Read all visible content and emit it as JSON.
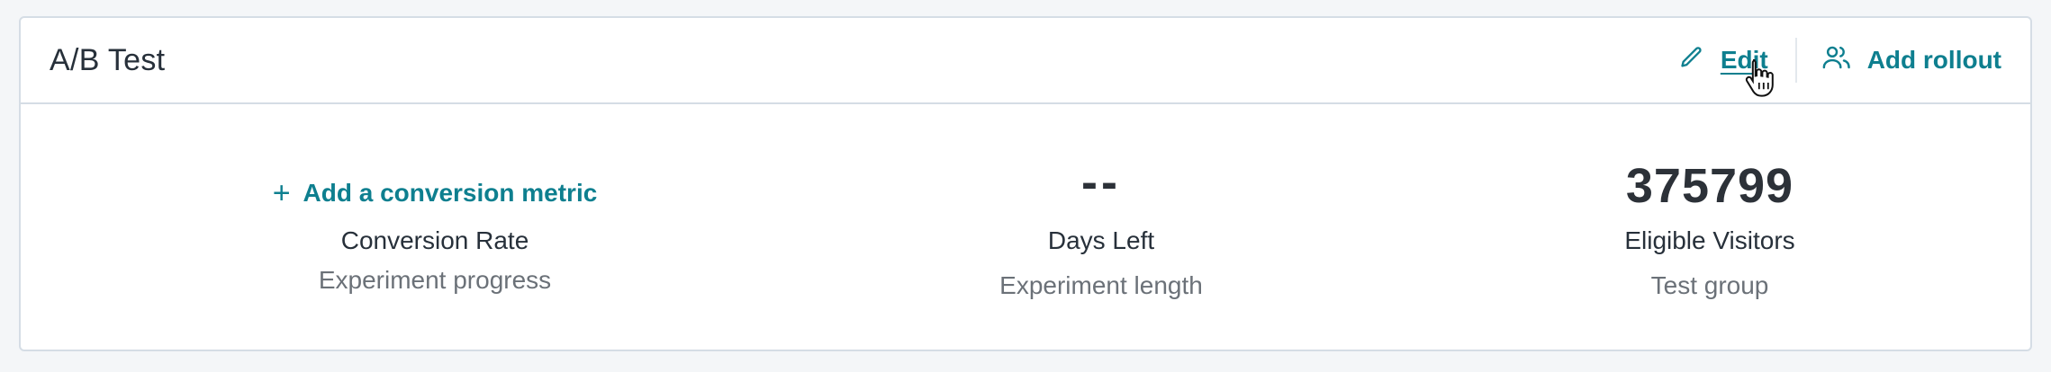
{
  "card": {
    "title": "A/B Test",
    "actions": {
      "edit_label": "Edit",
      "add_rollout_label": "Add rollout"
    }
  },
  "stats": [
    {
      "action_label": "Add a conversion metric",
      "action_icon": "plus-icon",
      "label": "Conversion Rate",
      "sub": "Experiment progress"
    },
    {
      "value": "--",
      "label": "Days Left",
      "sub": "Experiment length"
    },
    {
      "value": "375799",
      "label": "Eligible Visitors",
      "sub": "Test group"
    }
  ],
  "colors": {
    "accent": "#0e7f8f",
    "text": "#27303a",
    "muted": "#6b7178",
    "border": "#d5dde5"
  }
}
